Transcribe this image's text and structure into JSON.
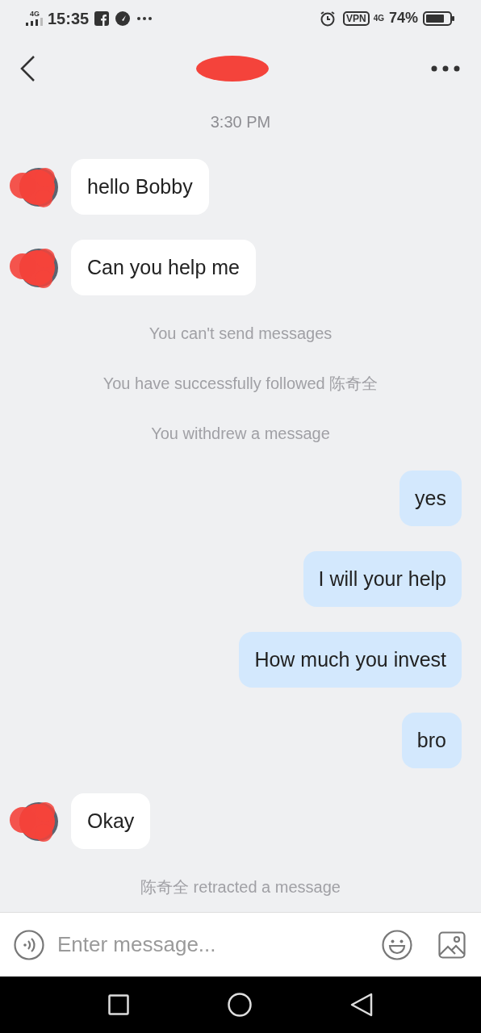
{
  "status_bar": {
    "network": "4G",
    "time": "15:35",
    "vpn": "VPN",
    "data": "4G",
    "battery": "74%"
  },
  "input": {
    "placeholder": "Enter message..."
  },
  "messages": [
    {
      "kind": "time",
      "text": "3:30 PM"
    },
    {
      "kind": "incoming",
      "text": "hello Bobby"
    },
    {
      "kind": "incoming",
      "text": "Can you help me"
    },
    {
      "kind": "system",
      "text": "You can't send messages"
    },
    {
      "kind": "system",
      "text": "You have successfully followed 陈奇全"
    },
    {
      "kind": "system",
      "text": "You withdrew a message"
    },
    {
      "kind": "outgoing",
      "text": "yes"
    },
    {
      "kind": "outgoing",
      "text": "I will your help"
    },
    {
      "kind": "outgoing",
      "text": "How much you invest"
    },
    {
      "kind": "outgoing",
      "text": "bro"
    },
    {
      "kind": "incoming",
      "text": "Okay"
    },
    {
      "kind": "system",
      "text": "陈奇全 retracted a message"
    }
  ]
}
